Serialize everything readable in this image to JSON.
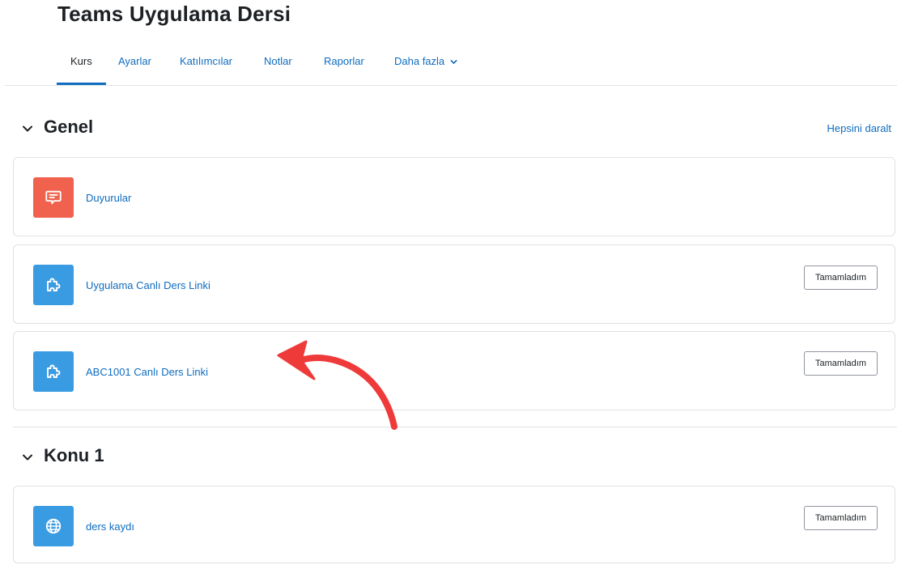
{
  "course": {
    "title": "Teams Uygulama Dersi"
  },
  "nav": {
    "tabs": [
      {
        "label": "Kurs",
        "active": true
      },
      {
        "label": "Ayarlar"
      },
      {
        "label": "Katılımcılar"
      },
      {
        "label": "Notlar"
      },
      {
        "label": "Raporlar"
      },
      {
        "label": "Daha fazla"
      }
    ],
    "more_icon": "chevron-down-icon"
  },
  "collapse_all_label": "Hepsini daralt",
  "sections": [
    {
      "title": "Genel",
      "activities": [
        {
          "name": "Duyurular",
          "icon": "forum-icon",
          "icon_color": "#f0624d"
        },
        {
          "name": "Uygulama Canlı Ders Linki",
          "icon": "puzzle-icon",
          "icon_color": "#399be2",
          "completion_label": "Tamamladım"
        },
        {
          "name": "ABC1001 Canlı Ders Linki",
          "icon": "puzzle-icon",
          "icon_color": "#399be2",
          "completion_label": "Tamamladım"
        }
      ]
    },
    {
      "title": "Konu 1",
      "activities": [
        {
          "name": "ders kaydı",
          "icon": "globe-icon",
          "icon_color": "#399be2",
          "completion_label": "Tamamladım"
        }
      ]
    }
  ],
  "annotation": {
    "type": "curved-arrow",
    "color": "#ef3a3a"
  }
}
